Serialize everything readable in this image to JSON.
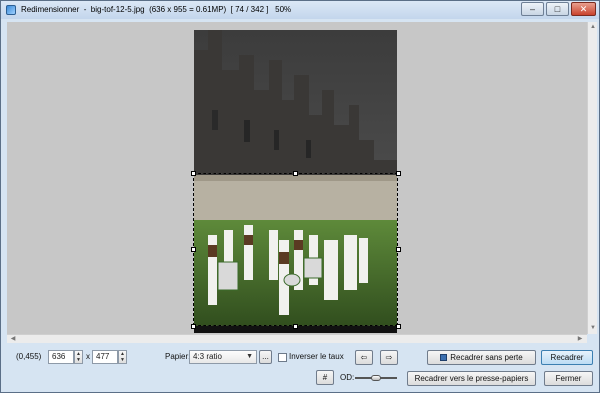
{
  "window": {
    "title": "Redimensionner  -  big-tof-12-5.jpg  (636 x 955 = 0.61MP)  [ 74 / 342 ]   50%",
    "minimize_glyph": "–",
    "maximize_glyph": "□",
    "close_glyph": "✕"
  },
  "status": {
    "coords": "(0,455)"
  },
  "size": {
    "width": "636",
    "separator": "x",
    "height": "477"
  },
  "paper": {
    "label": "Papier:",
    "selected": "4:3 ratio",
    "more_label": "..."
  },
  "invert": {
    "label": "Inverser le taux",
    "checked": false
  },
  "buttons": {
    "arrow_left": "⇦",
    "arrow_right": "⇨",
    "grid": "#",
    "lossless_crop": "Recadrer sans perte",
    "crop": "Recadrer",
    "crop_clipboard": "Recadrer vers le presse-papiers",
    "close": "Fermer"
  },
  "opacity": {
    "label": "OD:",
    "level": 0.5
  },
  "icons": {
    "up": "▲",
    "down": "▼",
    "dropdown": "▼",
    "scroll_up": "▲",
    "scroll_down": "▼",
    "scroll_left": "◀",
    "scroll_right": "▶"
  }
}
